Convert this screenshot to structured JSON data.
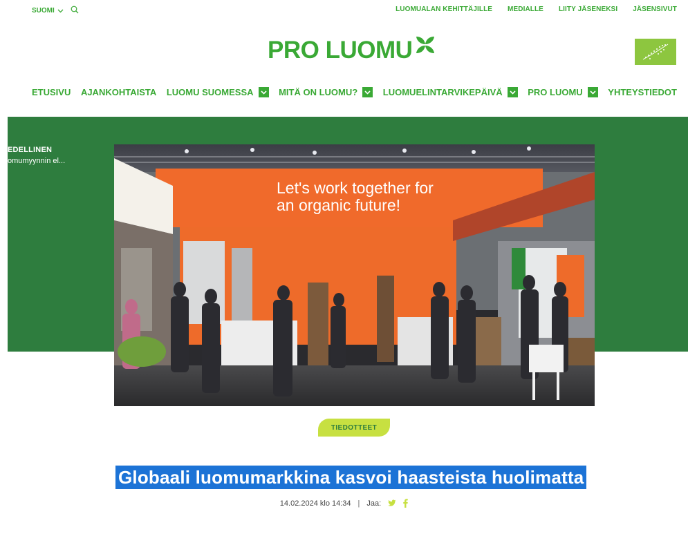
{
  "topbar": {
    "language": "SUOMI",
    "links": [
      "LUOMUALAN KEHITTÄJILLE",
      "MEDIALLE",
      "LIITY JÄSENEKSI",
      "JÄSENSIVUT"
    ]
  },
  "brand": {
    "logo_text": "PRO LUOMU",
    "accent": "#3aa935",
    "dark_green": "#2e7d3e",
    "lime": "#c7e041"
  },
  "nav": {
    "items": [
      {
        "label": "ETUSIVU"
      },
      {
        "label": "AJANKOHTAISTA"
      },
      {
        "label": "LUOMU SUOMESSA"
      },
      {
        "label": "MITÄ ON LUOMU?"
      },
      {
        "label": "LUOMUELINTARVIKEPÄIVÄ"
      },
      {
        "label": "PRO LUOMU"
      },
      {
        "label": "YHTEYSTIEDOT"
      }
    ]
  },
  "previous": {
    "title": "EDELLINEN",
    "subtitle": "omumyynnin el..."
  },
  "hero": {
    "banner_line1": "Let's work together for",
    "banner_line2": "an organic future!"
  },
  "article": {
    "category": "TIEDOTTEET",
    "title": "Globaali luomumarkkina kasvoi haasteista huolimatta",
    "date": "14.02.2024 klo 14:34",
    "separator": "|",
    "share_label": "Jaa:"
  }
}
